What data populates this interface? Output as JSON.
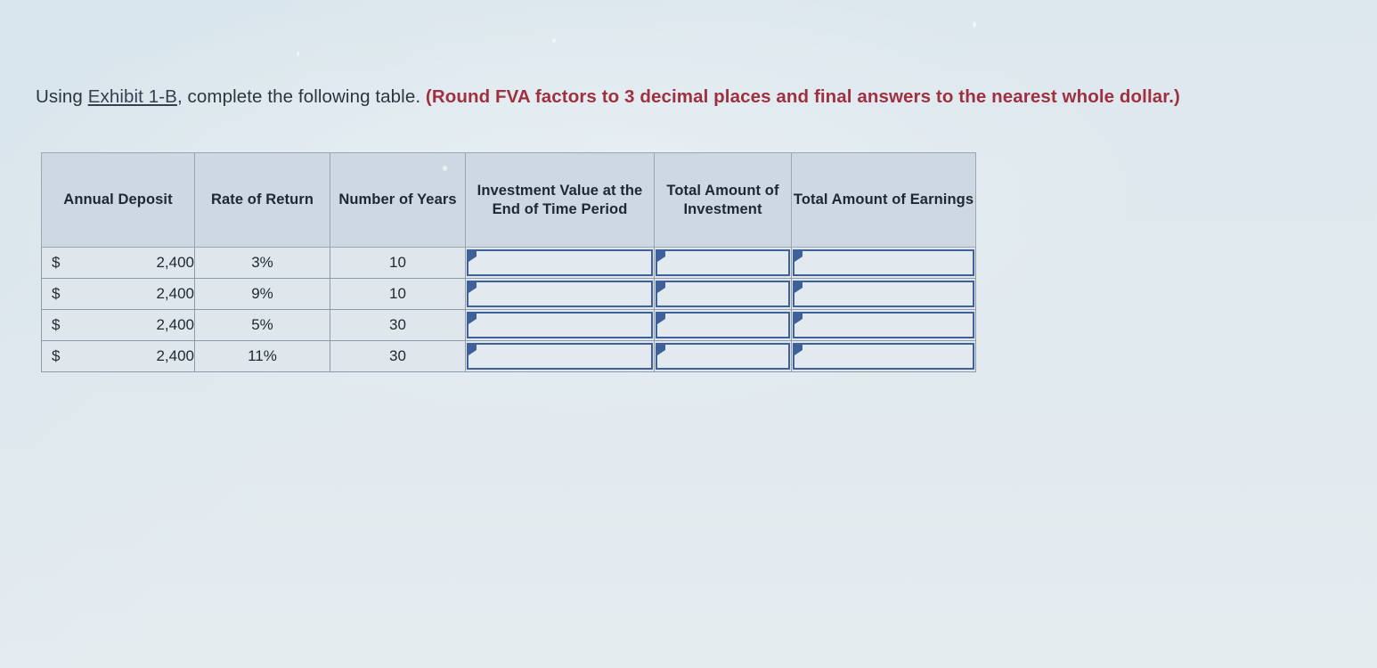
{
  "instruction": {
    "lead_before_link": "Using ",
    "link_text": "Exhibit 1-B",
    "lead_after_link": ", complete the following table. ",
    "emphasis": "(Round FVA factors to 3 decimal places and final answers to the nearest whole dollar.)"
  },
  "table": {
    "headers": [
      "Annual Deposit",
      "Rate of Return",
      "Number of Years",
      "Investment Value at the End of Time Period",
      "Total Amount of Investment",
      "Total Amount of Earnings"
    ],
    "rows": [
      {
        "currency_symbol": "$",
        "annual_deposit": "2,400",
        "rate_of_return": "3%",
        "number_of_years": "10",
        "investment_value": "",
        "total_investment": "",
        "total_earnings": ""
      },
      {
        "currency_symbol": "$",
        "annual_deposit": "2,400",
        "rate_of_return": "9%",
        "number_of_years": "10",
        "investment_value": "",
        "total_investment": "",
        "total_earnings": ""
      },
      {
        "currency_symbol": "$",
        "annual_deposit": "2,400",
        "rate_of_return": "5%",
        "number_of_years": "30",
        "investment_value": "",
        "total_investment": "",
        "total_earnings": ""
      },
      {
        "currency_symbol": "$",
        "annual_deposit": "2,400",
        "rate_of_return": "11%",
        "number_of_years": "30",
        "investment_value": "",
        "total_investment": "",
        "total_earnings": ""
      }
    ]
  },
  "colors": {
    "page_background": "#dce6ec",
    "header_cell": "#cdd8e2",
    "data_cell": "#dfe7ec",
    "grid_line": "#8e9ba8",
    "input_border": "#3f6098",
    "emphasis_text": "#9e3040",
    "body_text": "#2c3440",
    "link_text": "#33404f"
  }
}
